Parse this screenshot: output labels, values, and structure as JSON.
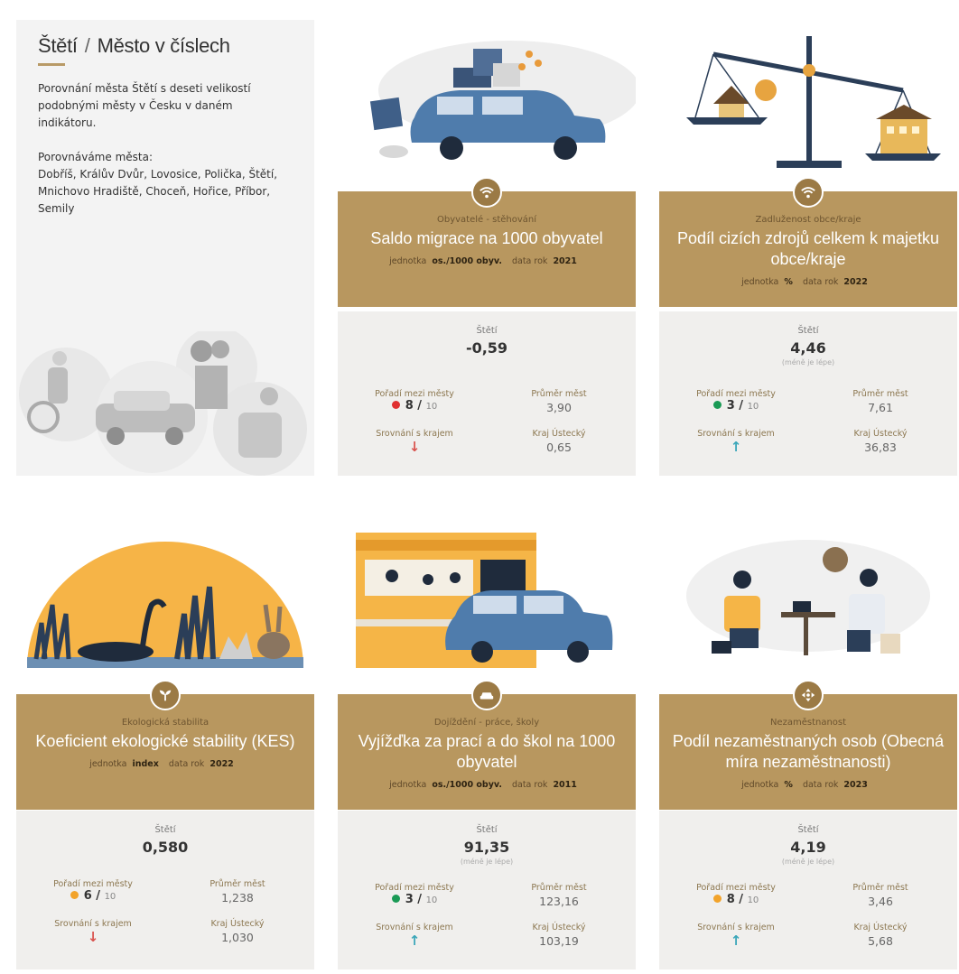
{
  "intro": {
    "city": "Štětí",
    "separator": "/",
    "section": "Město v číslech",
    "paragraph1": "Porovnání města Štětí s deseti velikostí podobnými městy v Česku v daném indikátoru.",
    "paragraph2_label": "Porovnáváme města:",
    "paragraph2_cities": "Dobříš, Králův Dvůr, Lovosice, Polička, Štětí, Mnichovo Hradiště, Choceň, Hořice, Příbor, Semily"
  },
  "colors": {
    "accent": "#b8975f",
    "red_dot": "#e03030",
    "green_dot": "#1a9a55",
    "orange_dot": "#f2a32a",
    "arrow_down": "#d9534f",
    "arrow_up": "#3aa6b9"
  },
  "cards": [
    {
      "icon": "wifi-icon",
      "category": "Obyvatelé - stěhování",
      "title": "Saldo migrace na 1000 obyvatel",
      "unit_label": "jednotka",
      "unit": "os./1000 obyv.",
      "year_label": "data rok",
      "year": "2021",
      "city_name": "Štětí",
      "city_value": "-0,59",
      "value_note": "",
      "rank_label": "Pořadí mezi městy",
      "rank": "8 /",
      "rank_total": "10",
      "rank_dot": "red",
      "avg_label": "Průměr měst",
      "avg_value": "3,90",
      "compare_label": "Srovnání s krajem",
      "compare_arrow": "↓",
      "compare_dir": "down",
      "region_label": "Kraj Ústecký",
      "region_value": "0,65"
    },
    {
      "icon": "wifi-icon",
      "category": "Zadluženost obce/kraje",
      "title": "Podíl cizích zdrojů celkem k majetku obce/kraje",
      "unit_label": "jednotka",
      "unit": "%",
      "year_label": "data rok",
      "year": "2022",
      "city_name": "Štětí",
      "city_value": "4,46",
      "value_note": "(méně je lépe)",
      "rank_label": "Pořadí mezi městy",
      "rank": "3 /",
      "rank_total": "10",
      "rank_dot": "green",
      "avg_label": "Průměr měst",
      "avg_value": "7,61",
      "compare_label": "Srovnání s krajem",
      "compare_arrow": "↑",
      "compare_dir": "up",
      "region_label": "Kraj Ústecký",
      "region_value": "36,83"
    },
    {
      "icon": "leaf-icon",
      "category": "Ekologická stabilita",
      "title": "Koeficient ekologické stability (KES)",
      "unit_label": "jednotka",
      "unit": "index",
      "year_label": "data rok",
      "year": "2022",
      "city_name": "Štětí",
      "city_value": "0,580",
      "value_note": "",
      "rank_label": "Pořadí mezi městy",
      "rank": "6 /",
      "rank_total": "10",
      "rank_dot": "orange",
      "avg_label": "Průměr měst",
      "avg_value": "1,238",
      "compare_label": "Srovnání s krajem",
      "compare_arrow": "↓",
      "compare_dir": "down",
      "region_label": "Kraj Ústecký",
      "region_value": "1,030"
    },
    {
      "icon": "car-icon",
      "category": "Dojíždění - práce, školy",
      "title": "Vyjížďka za prací a do škol na 1000 obyvatel",
      "unit_label": "jednotka",
      "unit": "os./1000 obyv.",
      "year_label": "data rok",
      "year": "2011",
      "city_name": "Štětí",
      "city_value": "91,35",
      "value_note": "(méně je lépe)",
      "rank_label": "Pořadí mezi městy",
      "rank": "3 /",
      "rank_total": "10",
      "rank_dot": "green",
      "avg_label": "Průměr měst",
      "avg_value": "123,16",
      "compare_label": "Srovnání s krajem",
      "compare_arrow": "↑",
      "compare_dir": "up",
      "region_label": "Kraj Ústecký",
      "region_value": "103,19"
    },
    {
      "icon": "arrows-icon",
      "category": "Nezaměstnanost",
      "title": "Podíl nezaměstnaných osob (Obecná míra nezaměstnanosti)",
      "unit_label": "jednotka",
      "unit": "%",
      "year_label": "data rok",
      "year": "2023",
      "city_name": "Štětí",
      "city_value": "4,19",
      "value_note": "(méně je lépe)",
      "rank_label": "Pořadí mezi městy",
      "rank": "8 /",
      "rank_total": "10",
      "rank_dot": "orange",
      "avg_label": "Průměr měst",
      "avg_value": "3,46",
      "compare_label": "Srovnání s krajem",
      "compare_arrow": "↑",
      "compare_dir": "up",
      "region_label": "Kraj Ústecký",
      "region_value": "5,68"
    }
  ]
}
